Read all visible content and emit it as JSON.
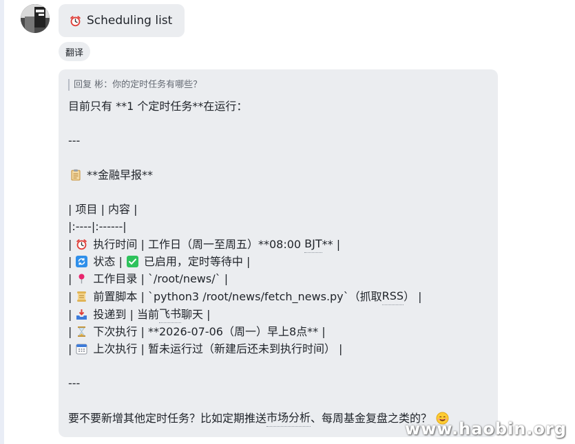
{
  "message_title": {
    "icon": "alarm-clock-icon",
    "text": "Scheduling list"
  },
  "translate_label": "翻译",
  "reply": {
    "quote": "回复 彬：你的定时任务有哪些？",
    "intro": "目前只有 **1 个定时任务**在运行：",
    "sep1": "---",
    "task_name": "**金融早报**",
    "table_header": "| 项目 | 内容 |",
    "table_align": "|:----|:------|",
    "rows": [
      {
        "icon": "alarm-clock-icon",
        "pre": "|",
        "text": "执行时间 | 工作日（周一至周五）**08:00 ",
        "dotted": "BJT",
        "post": "** |"
      },
      {
        "icon": "refresh-icon",
        "pre": "|",
        "text": "状态 |",
        "icon2": "check-icon",
        "text2": "已启用，定时等待中 |"
      },
      {
        "icon": "pin-icon",
        "pre": "|",
        "text": "工作目录 | `/root/news/` |"
      },
      {
        "icon": "scroll-icon",
        "pre": "|",
        "text": "前置脚本 | `python3 /root/news/fetch_news.py`（抓取",
        "dotted": "RSS",
        "post": "） |"
      },
      {
        "icon": "inbox-tray-icon",
        "pre": "|",
        "text": "投递到 | 当前",
        "dotted": "飞书",
        "post": "聊天 |"
      },
      {
        "icon": "hourglass-icon",
        "pre": "|",
        "text": "下次执行 | **2026-07-06（周一）早上8点** |"
      },
      {
        "icon": "calendar-icon",
        "pre": "|",
        "text": "上次执行 | 暂未运行过（新建后还未到执行时间） |"
      }
    ],
    "sep2": "---",
    "closing_pre": "要不要新增其他定时任务？比如定期推送",
    "closing_dotted": "市场分析",
    "closing_post": "、每周基金复盘之类的？",
    "closing_icon": "smiling-face-icon"
  },
  "watermark": "www.haobin.org"
}
